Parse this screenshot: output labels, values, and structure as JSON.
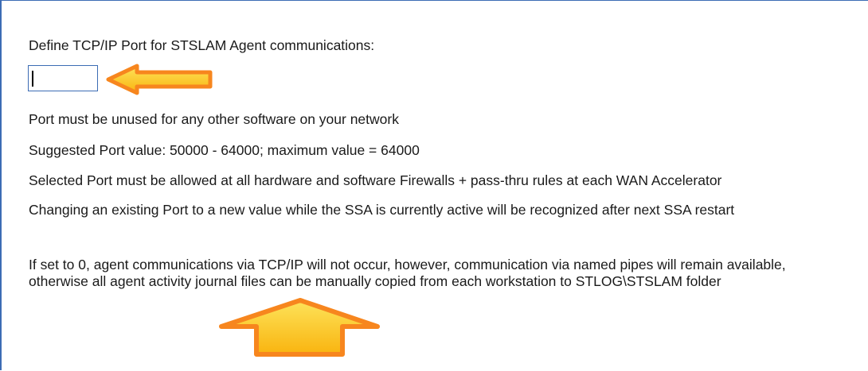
{
  "port_section": {
    "label": "Define TCP/IP Port for STSLAM Agent communications:",
    "port_value": "",
    "notes": [
      "Port must be unused for any other software on your network",
      "Suggested Port value: 50000 - 64000; maximum value = 64000",
      "Selected Port must be allowed at all hardware and software Firewalls + pass-thru rules at each WAN Accelerator",
      "Changing an existing Port to a new value while the SSA is currently active will be recognized after next SSA restart",
      "If set to 0, agent communications via TCP/IP will not occur, however, communication via named pipes will remain available, otherwise all agent activity journal files can be manually copied from each workstation to STLOG\\STSLAM folder"
    ]
  },
  "annotations": {
    "arrow_fill_color": "#fcc419",
    "arrow_stroke_color": "#f7861e",
    "arrows": [
      "left-arrow",
      "up-arrow"
    ]
  },
  "colors": {
    "panel_border": "#3c6cb4",
    "input_border": "#3c6cb4",
    "text": "#1a1a1a"
  }
}
